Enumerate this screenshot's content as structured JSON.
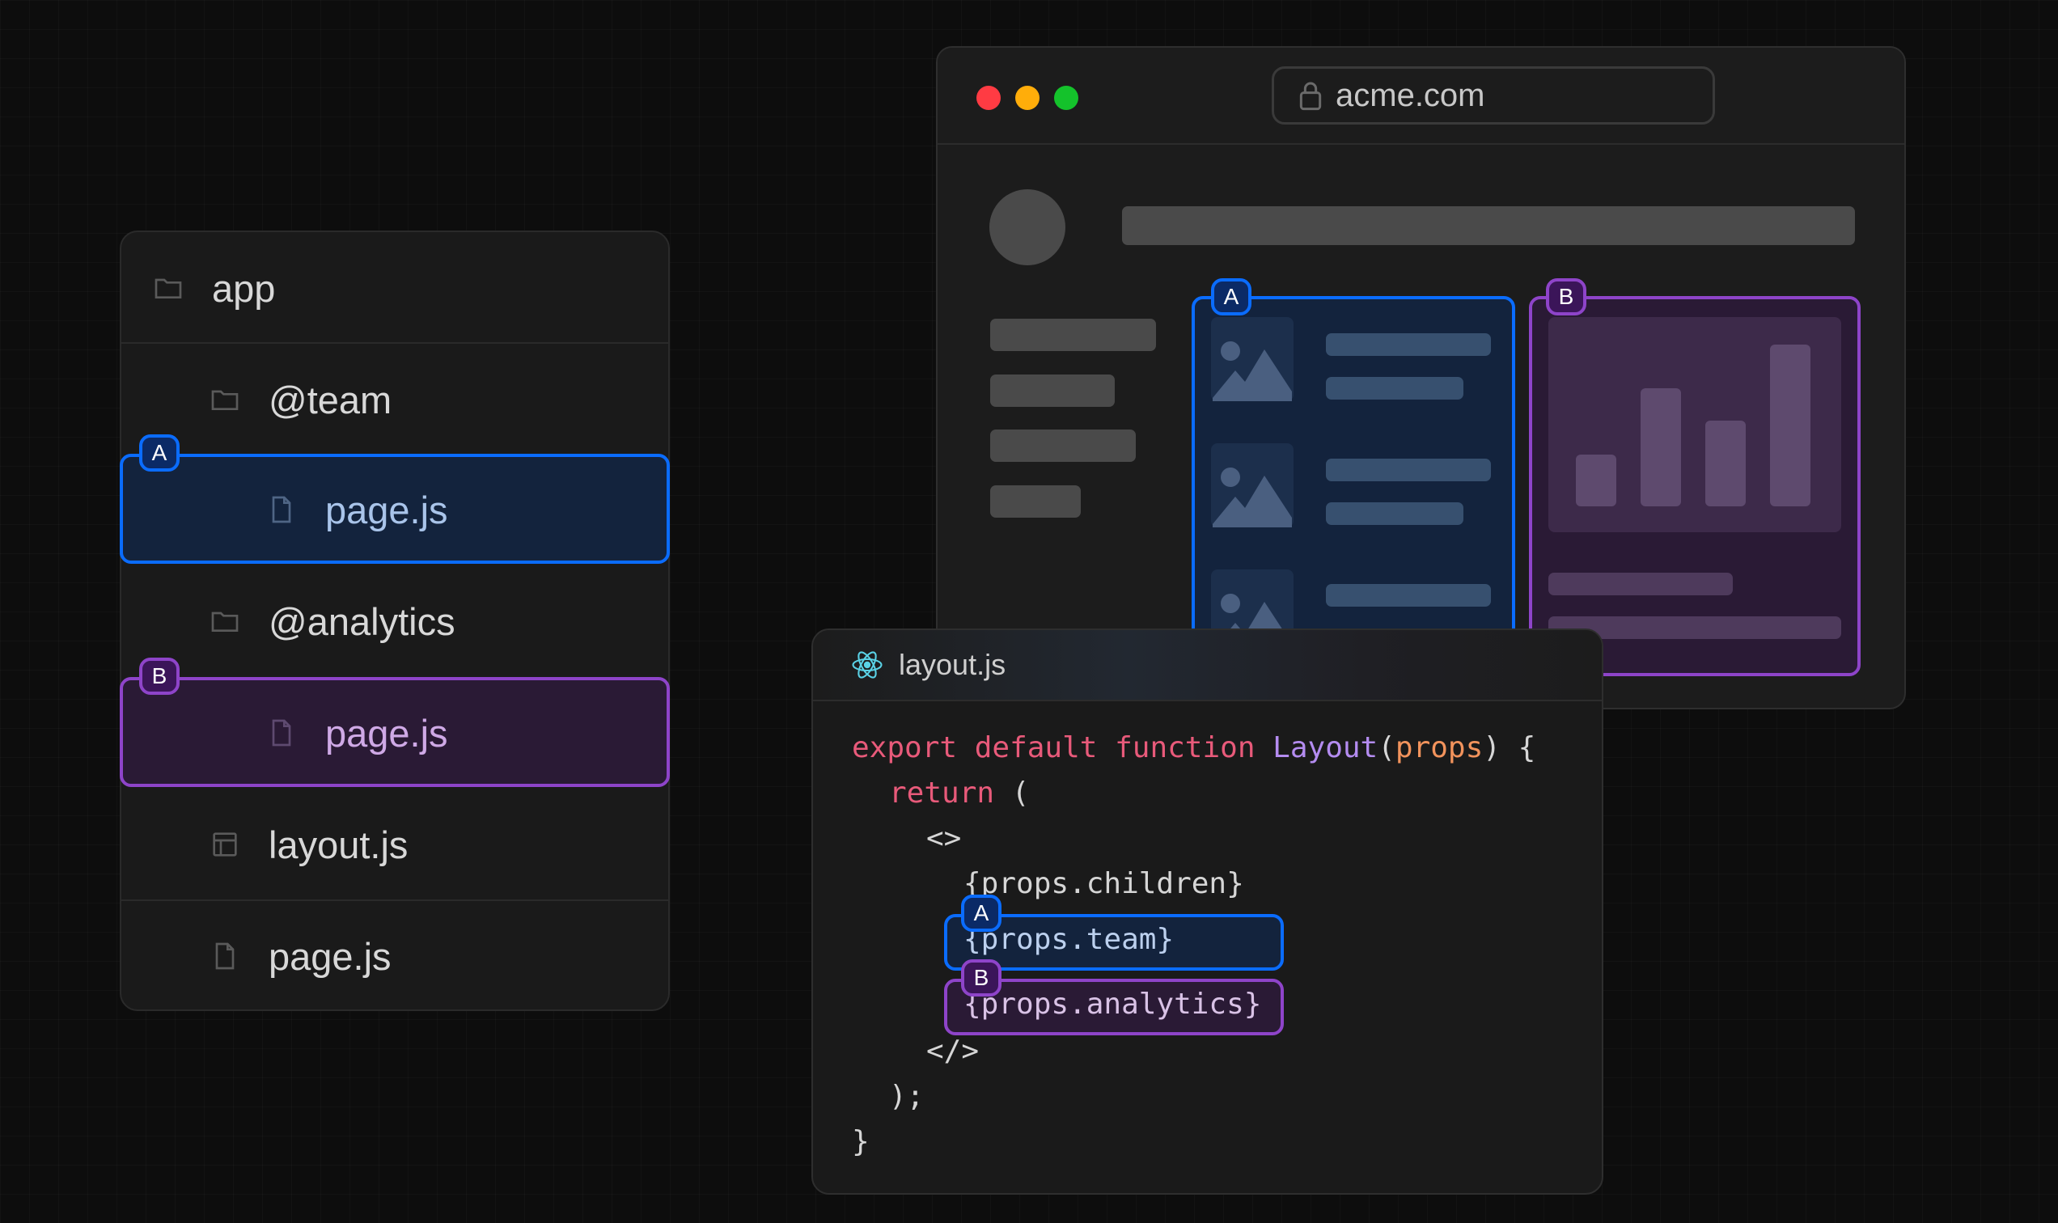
{
  "colors": {
    "slot_a": "#0a6cff",
    "slot_b": "#8e44c9",
    "keyword": "#e85a7a",
    "function_name": "#b48cf0",
    "param": "#f2935c",
    "react_icon": "#5ad2e6"
  },
  "file_tree": {
    "items": [
      {
        "label": "app",
        "icon": "folder-icon",
        "depth": 0
      },
      {
        "label": "@team",
        "icon": "folder-icon",
        "depth": 1
      },
      {
        "label": "page.js",
        "icon": "file-icon",
        "depth": 2,
        "slot": "A"
      },
      {
        "label": "@analytics",
        "icon": "folder-icon",
        "depth": 1
      },
      {
        "label": "page.js",
        "icon": "file-icon",
        "depth": 2,
        "slot": "B"
      },
      {
        "label": "layout.js",
        "icon": "layout-icon",
        "depth": 1
      },
      {
        "label": "page.js",
        "icon": "file-icon",
        "depth": 1
      }
    ]
  },
  "slots": {
    "a": "A",
    "b": "B"
  },
  "browser": {
    "url": "acme.com",
    "lock_icon": "lock-icon",
    "window_controls": [
      "close",
      "minimize",
      "maximize"
    ],
    "panel_a_label": "A",
    "panel_b_label": "B"
  },
  "code": {
    "filename": "layout.js",
    "file_icon": "react-icon",
    "lines": {
      "l1_kw": "export default function ",
      "l1_fn": "Layout",
      "l1_p1": "(",
      "l1_param": "props",
      "l1_p2": ") {",
      "l2_kw": "return",
      "l2_rest": " (",
      "l3": "<>",
      "l4": "{props.children}",
      "l5": "{props.team}",
      "l6": "{props.analytics}",
      "l7": "</>",
      "l8": ");",
      "l9": "}"
    }
  }
}
